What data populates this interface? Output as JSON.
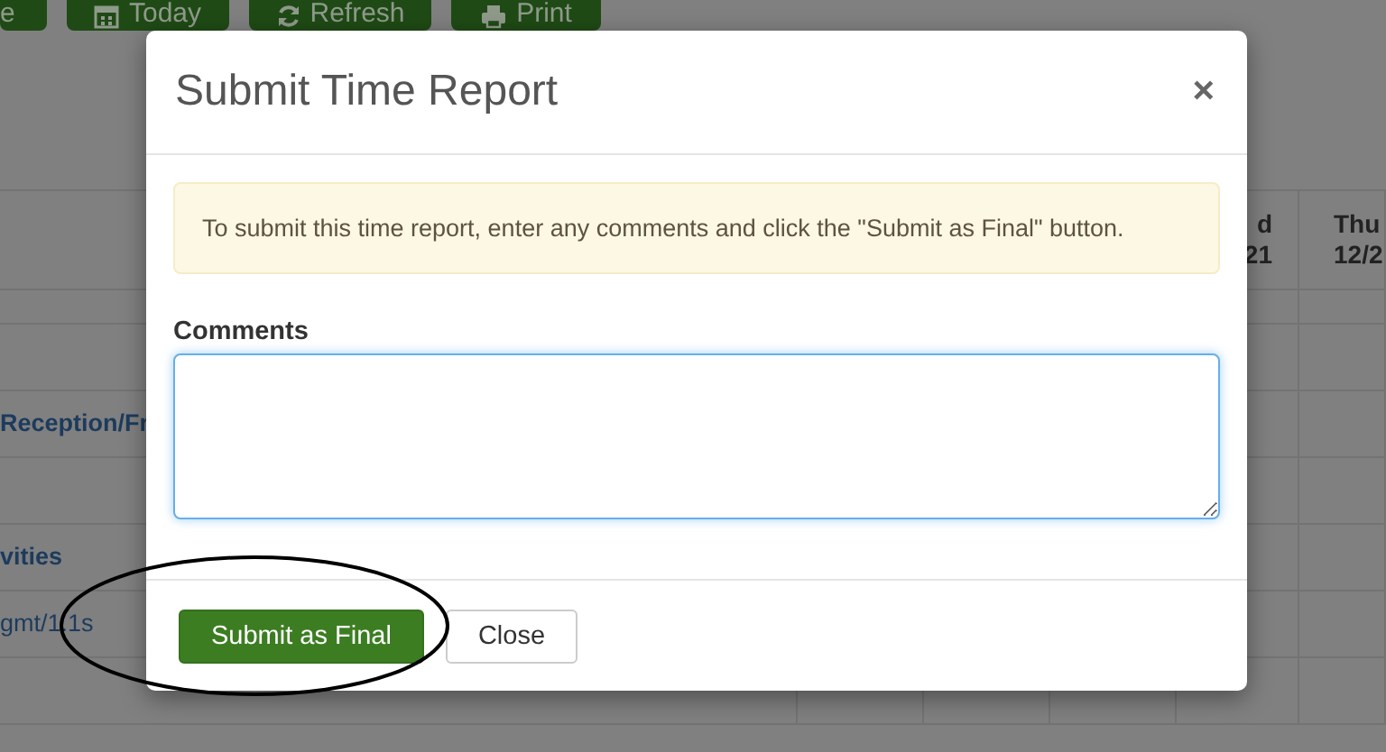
{
  "toolbar": {
    "buttons": [
      {
        "kind": "plain",
        "label": "e"
      },
      {
        "kind": "calendar",
        "label": "Today"
      },
      {
        "kind": "refresh",
        "label": "Refresh"
      },
      {
        "kind": "print",
        "label": "Print"
      }
    ]
  },
  "table": {
    "columns": [
      {
        "line1": "d",
        "line2": "21"
      },
      {
        "line1": "Thu",
        "line2": "12/2"
      }
    ],
    "rows": [
      {},
      {},
      {
        "label": "Reception/Fr",
        "bold": true
      },
      {},
      {
        "label": "vities",
        "bold": true
      },
      {
        "label": "gmt/1.1s",
        "bold": false
      },
      {}
    ]
  },
  "modal": {
    "title": "Submit Time Report",
    "close": "×",
    "alert": "To submit this time report, enter any comments and click the \"Submit as Final\" button.",
    "comments": {
      "label": "Comments",
      "focused": true
    },
    "buttons": [
      {
        "kind": "primary",
        "label": "Submit as Final"
      },
      {
        "kind": "default",
        "label": "Close"
      }
    ]
  }
}
